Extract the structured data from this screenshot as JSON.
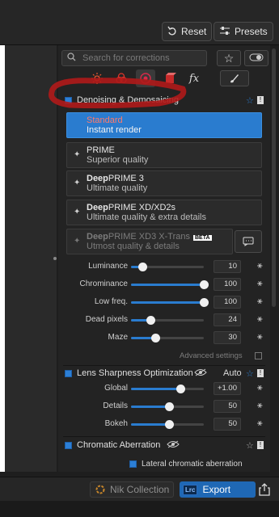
{
  "toolbar": {
    "reset_label": "Reset",
    "presets_label": "Presets"
  },
  "search": {
    "placeholder": "Search for corrections"
  },
  "tabs": [
    {
      "name": "light-tab",
      "color": "#e8542f"
    },
    {
      "name": "color-tab",
      "color": "#d9342b"
    },
    {
      "name": "detail-tab",
      "color": "#d92a4a"
    },
    {
      "name": "geometry-tab",
      "color": "#c72a2a"
    },
    {
      "name": "fx-tab",
      "label": "fx"
    }
  ],
  "denoising": {
    "title": "Denoising & Demosaicing",
    "modes": [
      {
        "title": "Standard",
        "subtitle": "Instant render"
      },
      {
        "title": "PRIME",
        "subtitle": "Superior quality"
      },
      {
        "title_bold": "Deep",
        "title_rest": "PRIME 3",
        "subtitle": "Ultimate quality"
      },
      {
        "title_bold": "Deep",
        "title_rest": "PRIME XD/XD2s",
        "subtitle": "Ultimate quality & extra details"
      },
      {
        "title_bold": "Deep",
        "title_rest": "PRIME XD3 X-Trans",
        "badge": "BETA",
        "subtitle": "Utmost quality & details"
      }
    ],
    "sliders": [
      {
        "label": "Luminance",
        "value": "10",
        "fraction": 0.15
      },
      {
        "label": "Chrominance",
        "value": "100",
        "fraction": 1.0
      },
      {
        "label": "Low freq.",
        "value": "100",
        "fraction": 1.0
      },
      {
        "label": "Dead pixels",
        "value": "24",
        "fraction": 0.27
      },
      {
        "label": "Maze",
        "value": "30",
        "fraction": 0.33
      }
    ],
    "advanced_label": "Advanced settings"
  },
  "lens_sharpness": {
    "title": "Lens Sharpness Optimization",
    "mode": "Auto",
    "sliders": [
      {
        "label": "Global",
        "value": "+1.00",
        "fraction": 0.68
      },
      {
        "label": "Details",
        "value": "50",
        "fraction": 0.52
      },
      {
        "label": "Bokeh",
        "value": "50",
        "fraction": 0.52
      }
    ]
  },
  "chromatic": {
    "title": "Chromatic Aberration",
    "option_label": "Lateral chromatic aberration"
  },
  "bottom": {
    "nik_label": "Nik Collection",
    "export_label": "Export",
    "lrc_badge": "Lrc"
  },
  "colors": {
    "accent": "#2a7ccf",
    "annotation": "#b01a1a"
  }
}
